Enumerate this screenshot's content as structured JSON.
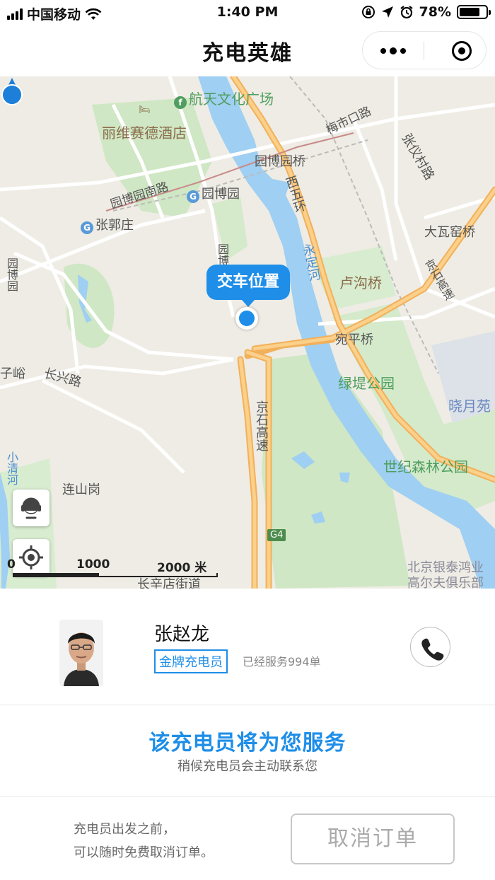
{
  "status_bar": {
    "carrier": "中国移动",
    "time": "1:40 PM",
    "battery": "78%",
    "battery_level": 0.78,
    "icons": [
      "signal-icon",
      "wifi-icon",
      "rotation-lock-icon",
      "location-arrow-icon",
      "alarm-icon",
      "battery-icon"
    ]
  },
  "nav": {
    "title": "充电英雄",
    "more_icon": "more-dots-icon",
    "close_icon": "close-circle-icon"
  },
  "map": {
    "callout": "交车位置",
    "labels": {
      "plaza": "航天文化广场",
      "hotel": "丽维赛德酒店",
      "meishikou": "梅市口路",
      "yuanbo_bridge": "园博园桥",
      "yuanbo_south": "园博园南路",
      "yuanbo_station": "园博园",
      "zhangguozhuang": "张郭庄",
      "zhangyi": "张仪村路",
      "dawayao": "大瓦窑桥",
      "xiwuhuan": "西五环",
      "yongding": "永定河",
      "lugou": "卢沟桥",
      "jingshi_gaosu_r": "京石高速",
      "wanping": "宛平桥",
      "yuanbo_road": "园博",
      "yuan_left": "园博园",
      "zi_yu": "子峪",
      "changxing": "长兴路",
      "lvdi": "绿堤公园",
      "xiaoyue": "晓月苑",
      "jingshi_gaosu": "京石高速",
      "shiji": "世纪森林公园",
      "xiaoqing": "小清河",
      "lianshan": "连山岗",
      "g4": "G4",
      "yintai": "北京银泰鸿业",
      "golf": "高尔夫俱乐部",
      "changxindian": "长辛店街道"
    },
    "scale": {
      "zero": "0",
      "mid": "1000",
      "end": "2000 米"
    },
    "buttons": {
      "service": "customer-service-icon",
      "locate": "locate-crosshair-icon"
    }
  },
  "driver": {
    "name": "张赵龙",
    "badge": "金牌充电员",
    "served": "已经服务994单",
    "avatar": "driver-photo",
    "phone_icon": "phone-icon"
  },
  "service": {
    "title": "该充电员将为您服务",
    "subtitle": "稍候充电员会主动联系您"
  },
  "cancel": {
    "note_line1": "充电员出发之前，",
    "note_line2": "可以随时免费取消订单。",
    "button": "取消订单"
  }
}
